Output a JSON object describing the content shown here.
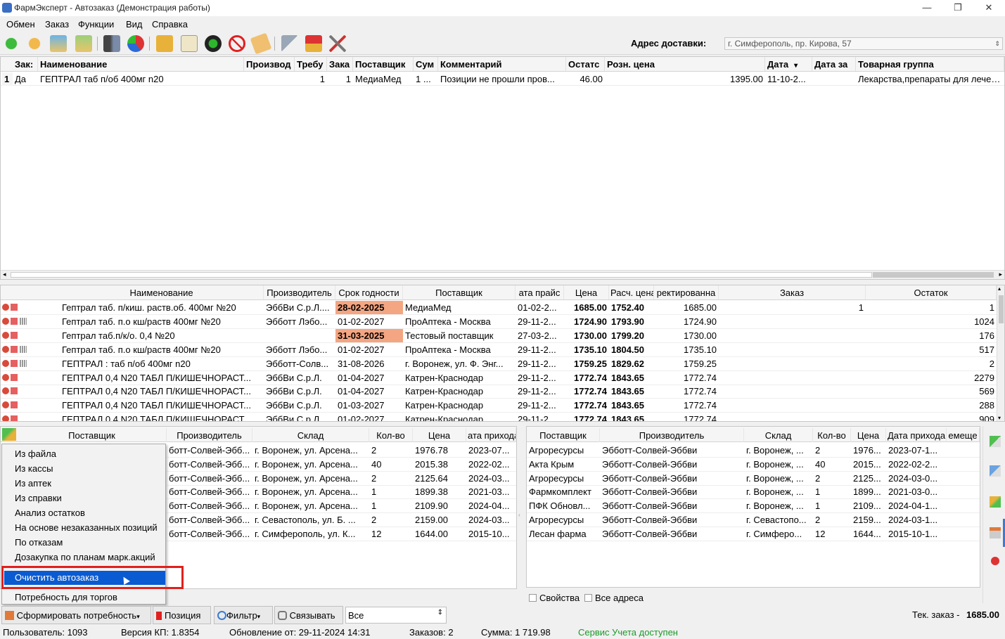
{
  "window": {
    "title": "ФармЭксперт - Автозаказ (Демонстрация работы)",
    "minimize": "—",
    "restore": "❐",
    "close": "✕"
  },
  "menu": [
    "Обмен",
    "Заказ",
    "Функции",
    "Вид",
    "Справка"
  ],
  "toolbar": {
    "icons": [
      "refresh-green-icon",
      "refresh-orange-icon",
      "upload-icon",
      "download-icon",
      "binoculars-icon",
      "pie-chart-icon",
      "box-icon",
      "clipboard-icon",
      "power-icon",
      "stop-icon",
      "tag-icon",
      "flag-icon",
      "house-icon",
      "tools-icon"
    ],
    "address_label": "Адрес доставки:",
    "address_value": "г. Симферополь, пр. Кирова, 57"
  },
  "top_grid": {
    "headers": [
      "Зак:",
      "Наименование",
      "Производ",
      "Требу",
      "Зака",
      "Поставщик",
      "Сум",
      "Комментарий",
      "Остатс",
      "Розн. цена",
      "Дата",
      "Дата за",
      "Товарная группа"
    ],
    "rows": [
      {
        "num": "1",
        "zak": "Да",
        "name": "ГЕПТРАЛ таб п/об 400мг n20",
        "proizv": "",
        "treb": "1",
        "zakaz": "1",
        "post": "МедиаМед",
        "sum": "1 ...",
        "comment": "Позиции не прошли пров...",
        "ost": "46.00",
        "price": "1395.00",
        "date": "11-10-2...",
        "date2": "",
        "group": "Лекарства,препараты для лечения"
      }
    ]
  },
  "mid_grid": {
    "headers": [
      "Наименование",
      "Производитель",
      "Срок годности",
      "Поставщик",
      "ата прайс",
      "Цена",
      "Расч. цена",
      "ректированна",
      "Заказ",
      "Остаток"
    ],
    "rows": [
      {
        "icons": "rb",
        "name": "Гептрал таб. п/киш. раств.об. 400мг №20",
        "proizv": "ЭббВи С.р.Л....",
        "srok": "28-02-2025",
        "srok_hl": true,
        "post": "МедиаМед",
        "date": "01-02-2...",
        "price": "1685.00",
        "calc": "1752.40",
        "corr": "1685.00",
        "order": "1",
        "ost": "1"
      },
      {
        "icons": "rbg",
        "name": "Гептрал таб. п.о кш/раств 400мг №20",
        "proizv": "Эбботт Лэбо...",
        "srok": "01-02-2027",
        "srok_hl": false,
        "post": "ПроАптека - Москва",
        "date": "29-11-2...",
        "price": "1724.90",
        "calc": "1793.90",
        "corr": "1724.90",
        "order": "",
        "ost": "1024"
      },
      {
        "icons": "rb",
        "name": "Гептрал таб.п/к/о. 0,4 №20",
        "proizv": "",
        "srok": "31-03-2025",
        "srok_hl": true,
        "post": "Тестовый поставщик",
        "date": "27-03-2...",
        "price": "1730.00",
        "calc": "1799.20",
        "corr": "1730.00",
        "order": "",
        "ost": "176"
      },
      {
        "icons": "rbg",
        "name": "Гептрал таб. п.о кш/раств 400мг №20",
        "proizv": "Эбботт Лэбо...",
        "srok": "01-02-2027",
        "srok_hl": false,
        "post": "ПроАптека - Москва",
        "date": "29-11-2...",
        "price": "1735.10",
        "calc": "1804.50",
        "corr": "1735.10",
        "order": "",
        "ost": "517"
      },
      {
        "icons": "rbg",
        "name": "ГЕПТРАЛ : таб п/об 400мг n20",
        "proizv": "Эбботт-Солв...",
        "srok": "31-08-2026",
        "srok_hl": false,
        "post": "г. Воронеж, ул. Ф. Энг...",
        "date": "29-11-2...",
        "price": "1759.25",
        "calc": "1829.62",
        "corr": "1759.25",
        "order": "",
        "ost": "2"
      },
      {
        "icons": "rb",
        "name": "ГЕПТРАЛ 0,4 N20 ТАБЛ П/КИШЕЧНОРАСТ...",
        "proizv": "ЭббВи С.р.Л.",
        "srok": "01-04-2027",
        "srok_hl": false,
        "post": "Катрен-Краснодар",
        "date": "29-11-2...",
        "price": "1772.74",
        "calc": "1843.65",
        "corr": "1772.74",
        "order": "",
        "ost": "2279"
      },
      {
        "icons": "rb",
        "name": "ГЕПТРАЛ 0,4 N20 ТАБЛ П/КИШЕЧНОРАСТ...",
        "proizv": "ЭббВи С.р.Л.",
        "srok": "01-04-2027",
        "srok_hl": false,
        "post": "Катрен-Краснодар",
        "date": "29-11-2...",
        "price": "1772.74",
        "calc": "1843.65",
        "corr": "1772.74",
        "order": "",
        "ost": "569"
      },
      {
        "icons": "rb",
        "name": "ГЕПТРАЛ 0,4 N20 ТАБЛ П/КИШЕЧНОРАСТ...",
        "proizv": "ЭббВи С.р.Л.",
        "srok": "01-03-2027",
        "srok_hl": false,
        "post": "Катрен-Краснодар",
        "date": "29-11-2...",
        "price": "1772.74",
        "calc": "1843.65",
        "corr": "1772.74",
        "order": "",
        "ost": "288"
      },
      {
        "icons": "rb",
        "name": "ГЕПТРАЛ 0,4 N20 ТАБЛ П/КИШЕЧНОРАСТ...",
        "proizv": "ЭббВи С.р.Л.",
        "srok": "01-02-2027",
        "srok_hl": false,
        "post": "Катрен-Краснодар",
        "date": "29-11-2...",
        "price": "1772.74",
        "calc": "1843.65",
        "corr": "1772.74",
        "order": "",
        "ost": "909"
      }
    ]
  },
  "bottom_left": {
    "headers": [
      "Поставщик",
      "Производитель",
      "Склад",
      "Кол-во",
      "Цена",
      "ата прихода"
    ],
    "rows": [
      {
        "proizv": "ботт-Солвей-Эбб...",
        "sklad": "г. Воронеж, ул. Арсена...",
        "qty": "2",
        "price": "1976.78",
        "date": "2023-07..."
      },
      {
        "proizv": "ботт-Солвей-Эбб...",
        "sklad": "г. Воронеж, ул. Арсена...",
        "qty": "40",
        "price": "2015.38",
        "date": "2022-02..."
      },
      {
        "proizv": "ботт-Солвей-Эбб...",
        "sklad": "г. Воронеж, ул. Арсена...",
        "qty": "2",
        "price": "2125.64",
        "date": "2024-03..."
      },
      {
        "proizv": "ботт-Солвей-Эбб...",
        "sklad": "г. Воронеж, ул. Арсена...",
        "qty": "1",
        "price": "1899.38",
        "date": "2021-03..."
      },
      {
        "proizv": "ботт-Солвей-Эбб...",
        "sklad": "г. Воронеж, ул. Арсена...",
        "qty": "1",
        "price": "2109.90",
        "date": "2024-04..."
      },
      {
        "proizv": "ботт-Солвей-Эбб...",
        "sklad": "г. Севастополь, ул. Б. ...",
        "qty": "2",
        "price": "2159.00",
        "date": "2024-03..."
      },
      {
        "proizv": "ботт-Солвей-Эбб...",
        "sklad": "г. Симферополь, ул. К...",
        "qty": "12",
        "price": "1644.00",
        "date": "2015-10..."
      }
    ]
  },
  "bottom_right": {
    "headers": [
      "Поставщик",
      "Производитель",
      "Склад",
      "Кол-во",
      "Цена",
      "Дата прихода",
      "емеще"
    ],
    "rows": [
      {
        "post": "Агроресурсы",
        "proizv": "Эбботт-Солвей-Эббви",
        "sklad": "г. Воронеж, ...",
        "qty": "2",
        "price": "1976...",
        "date": "2023-07-1..."
      },
      {
        "post": "Акта Крым",
        "proizv": "Эбботт-Солвей-Эббви",
        "sklad": "г. Воронеж, ...",
        "qty": "40",
        "price": "2015...",
        "date": "2022-02-2..."
      },
      {
        "post": "Агроресурсы",
        "proizv": "Эбботт-Солвей-Эббви",
        "sklad": "г. Воронеж, ...",
        "qty": "2",
        "price": "2125...",
        "date": "2024-03-0..."
      },
      {
        "post": "Фармкомплект",
        "proizv": "Эбботт-Солвей-Эббви",
        "sklad": "г. Воронеж, ...",
        "qty": "1",
        "price": "1899...",
        "date": "2021-03-0..."
      },
      {
        "post": "ПФК Обновл...",
        "proizv": "Эбботт-Солвей-Эббви",
        "sklad": "г. Воронеж, ...",
        "qty": "1",
        "price": "2109...",
        "date": "2024-04-1..."
      },
      {
        "post": "Агроресурсы",
        "proizv": "Эбботт-Солвей-Эббви",
        "sklad": "г. Севастопо...",
        "qty": "2",
        "price": "2159...",
        "date": "2024-03-1..."
      },
      {
        "post": "Лесан фарма",
        "proizv": "Эбботт-Солвей-Эббви",
        "sklad": "г. Симферо...",
        "qty": "12",
        "price": "1644...",
        "date": "2015-10-1..."
      }
    ],
    "chk_props": "Свойства",
    "chk_all": "Все адреса"
  },
  "popup": {
    "items": [
      "Из файла",
      "Из кассы",
      "Из аптек",
      "Из справки",
      "Анализ остатков",
      "На основе незаказанных позиций",
      "По отказам",
      "Дозакупка по планам марк.акций",
      "Очистить автозаказ",
      "Потребность для торгов"
    ],
    "selected_index": 8
  },
  "bottom_buttons": {
    "form": "Сформировать потребность",
    "position": "Позиция",
    "filter": "Фильтр",
    "link": "Связывать",
    "select_value": "Все",
    "cur_order_label": "Тек. заказ -",
    "cur_order_value": "1685.00"
  },
  "status": {
    "user": "Пользователь: 1093",
    "version": "Версия КП: 1.8354",
    "update": "Обновление от: 29-11-2024 14:31",
    "orders": "Заказов: 2",
    "sum": "Сумма: 1 719.98",
    "service": "Сервис Учета доступен",
    "service_color": "#1a9a2a"
  }
}
